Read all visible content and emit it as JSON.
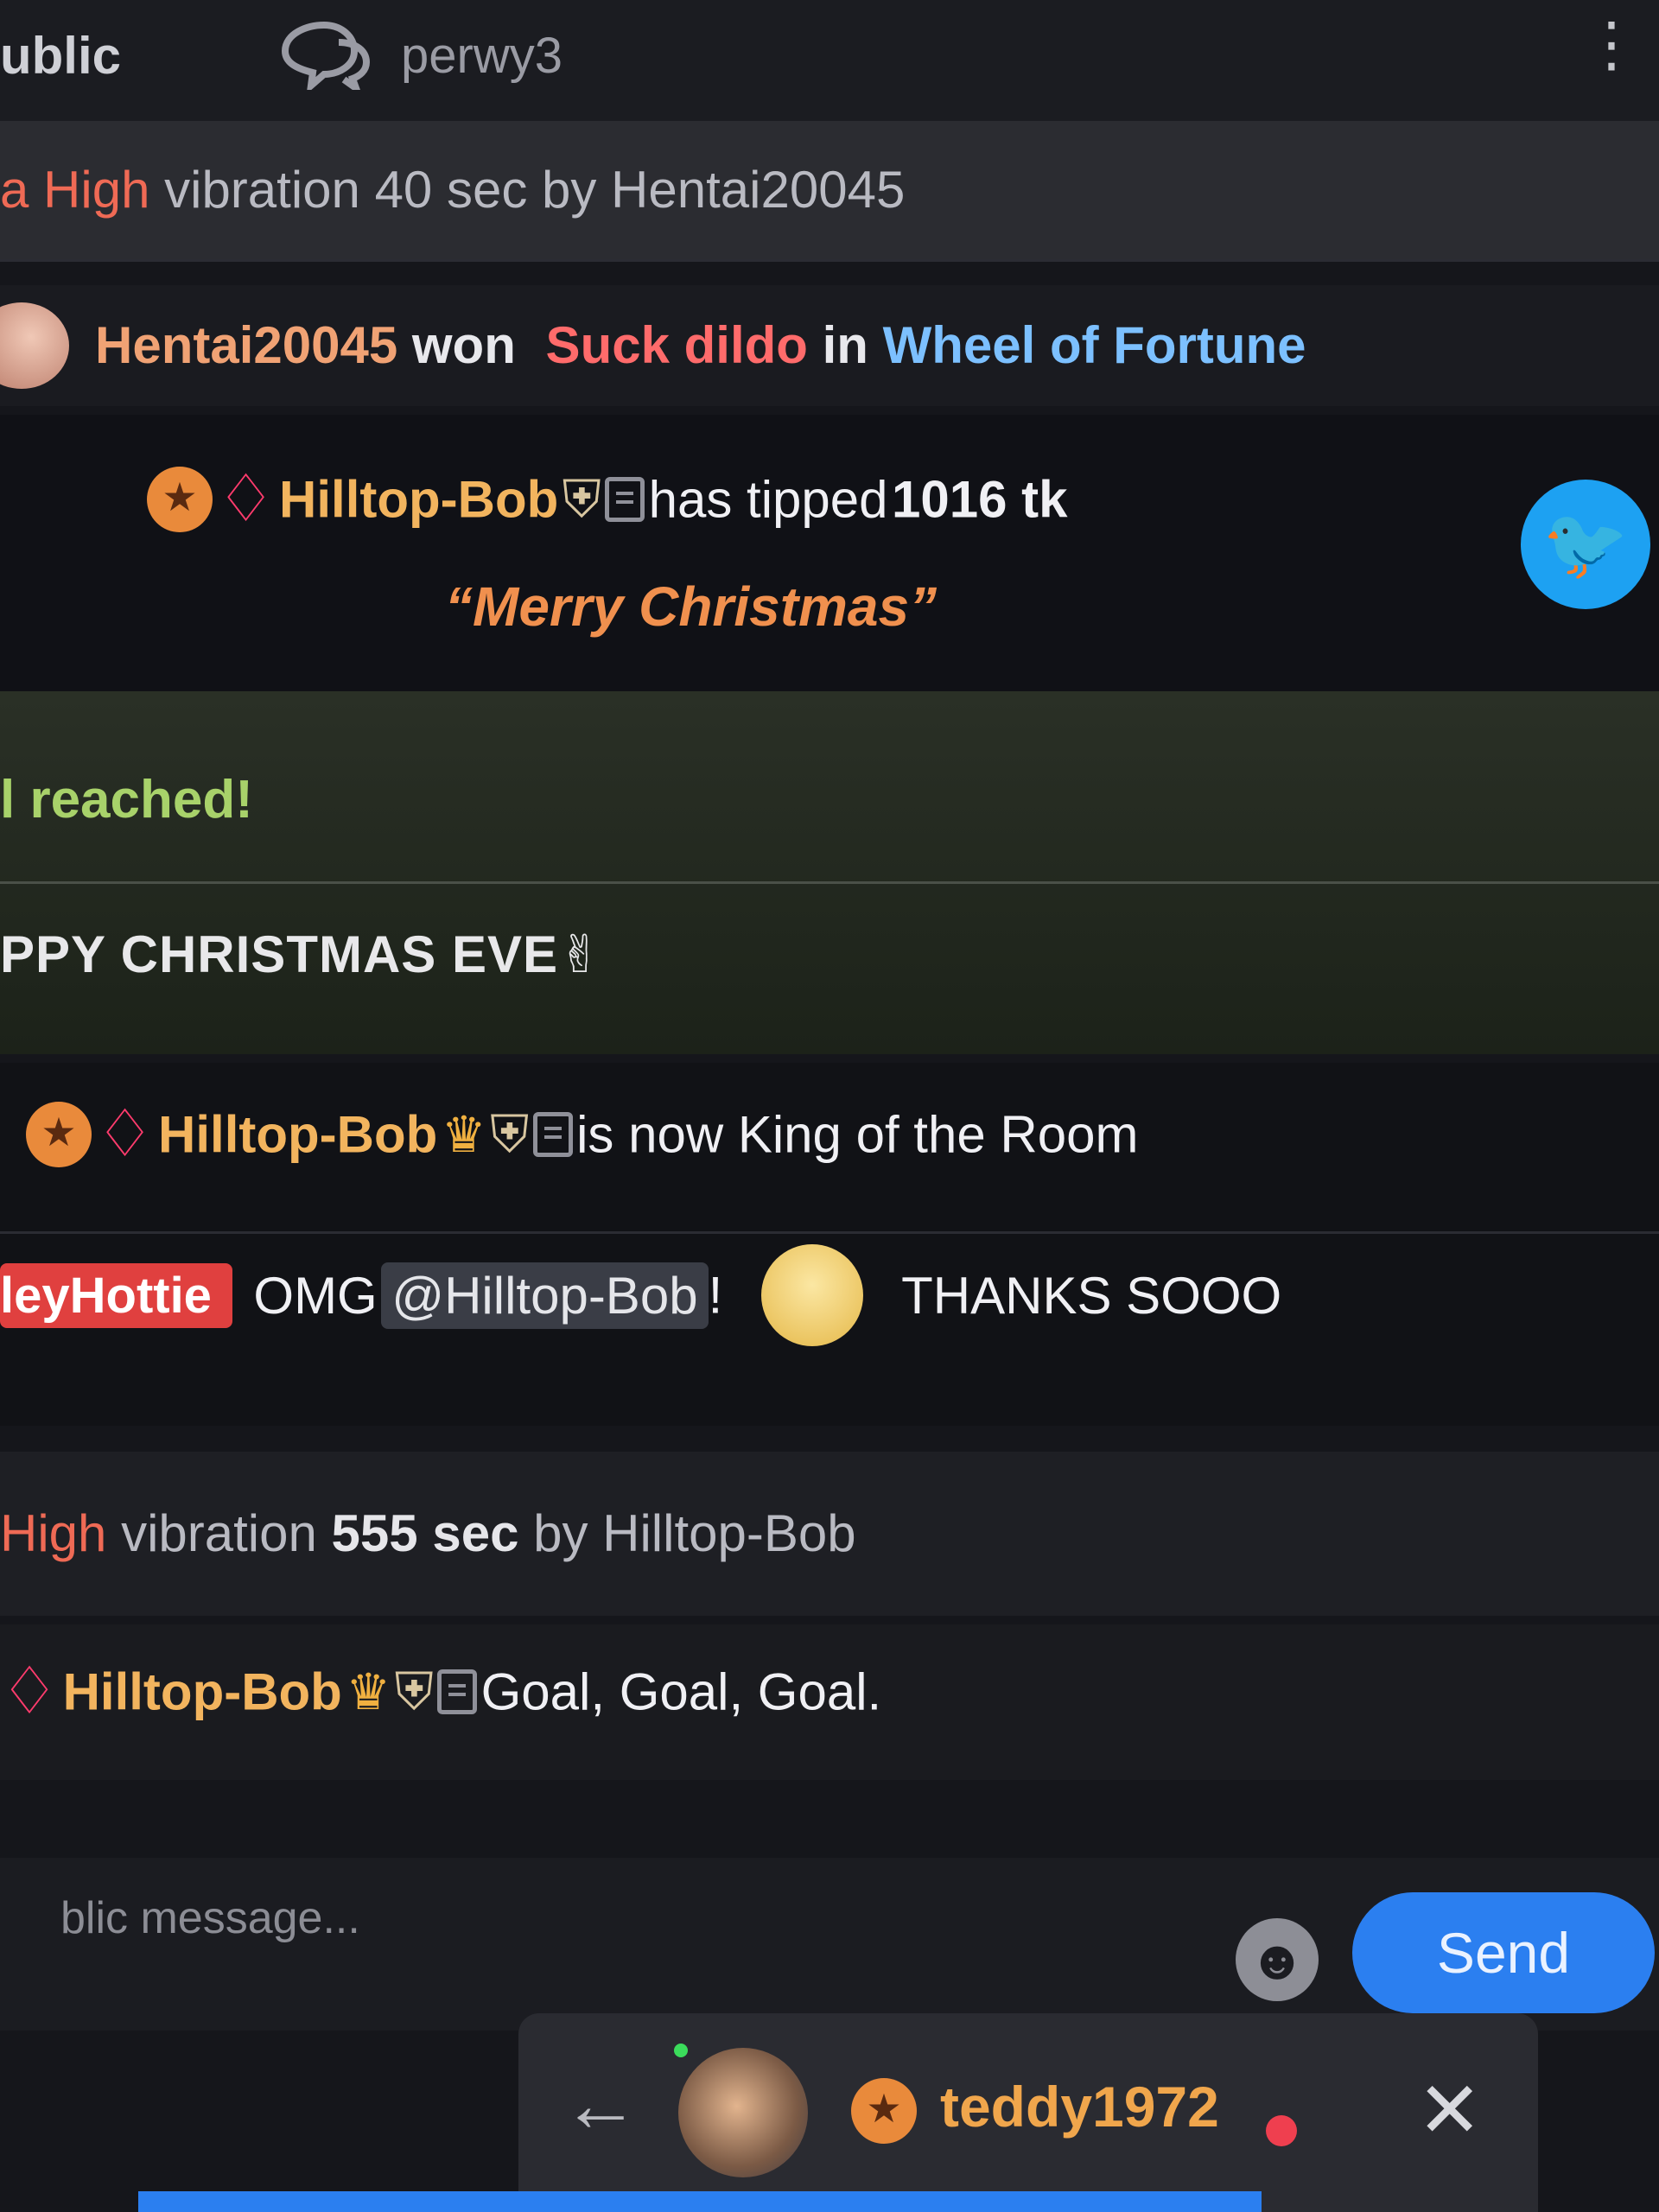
{
  "header": {
    "tab_public": "ublic",
    "username": "perwy3",
    "menu_icon": "kebab-icon"
  },
  "messages": {
    "vibration_1": {
      "prefix": "a High",
      "text": "vibration 40 sec by Hentai20045"
    },
    "win": {
      "user": "Hentai20045",
      "won": "won",
      "prize": "Suck dildo",
      "in": "in",
      "game": "Wheel of Fortune"
    },
    "tip": {
      "user": "Hilltop-Bob",
      "text": "has tipped",
      "amount": "1016 tk",
      "quote": "“Merry Christmas”"
    },
    "goal": {
      "text": "l reached!"
    },
    "xmas": {
      "text": "PPY CHRISTMAS EVE"
    },
    "king": {
      "user": "Hilltop-Bob",
      "text": "is now King of the Room"
    },
    "thanks": {
      "user": "leyHottie",
      "text": "OMG",
      "mention": "@Hilltop-Bob",
      "bang": "!",
      "text2": "THANKS SOOO"
    },
    "vibration_2": {
      "prefix": "High",
      "text": "vibration",
      "secs": "555 sec",
      "by": "by Hilltop-Bob"
    },
    "goal_msg": {
      "user": "Hilltop-Bob",
      "text": "Goal, Goal, Goal."
    }
  },
  "composer": {
    "placeholder": "blic message...",
    "send_label": "Send"
  },
  "dock": {
    "username": "teddy1972"
  }
}
